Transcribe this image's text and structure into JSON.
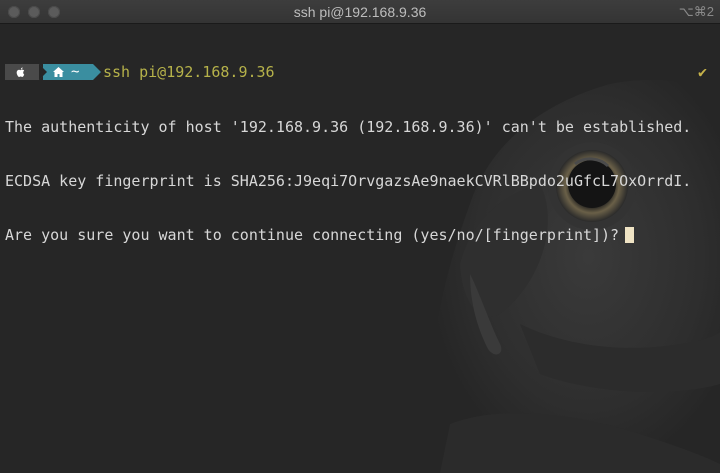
{
  "window": {
    "title": "ssh pi@192.168.9.36",
    "shortcut": "⌥⌘2"
  },
  "prompt": {
    "os_icon": "apple-icon",
    "home_icon": "home-icon",
    "directory": "~",
    "command": "ssh pi@192.168.9.36",
    "status_glyph": "✔"
  },
  "output": [
    "The authenticity of host '192.168.9.36 (192.168.9.36)' can't be established.",
    "ECDSA key fingerprint is SHA256:J9eqi7OrvgazsAe9naekCVRlBBpdo2uGfcL7OxOrrdI.",
    "Are you sure you want to continue connecting (yes/no/[fingerprint])?"
  ],
  "colors": {
    "background": "#262626",
    "prompt_segment_os": "#4a4a4a",
    "prompt_segment_dir": "#3a8ea0",
    "command_text": "#b6b24a",
    "status_check": "#c6b24a",
    "cursor": "#efe3c4"
  }
}
